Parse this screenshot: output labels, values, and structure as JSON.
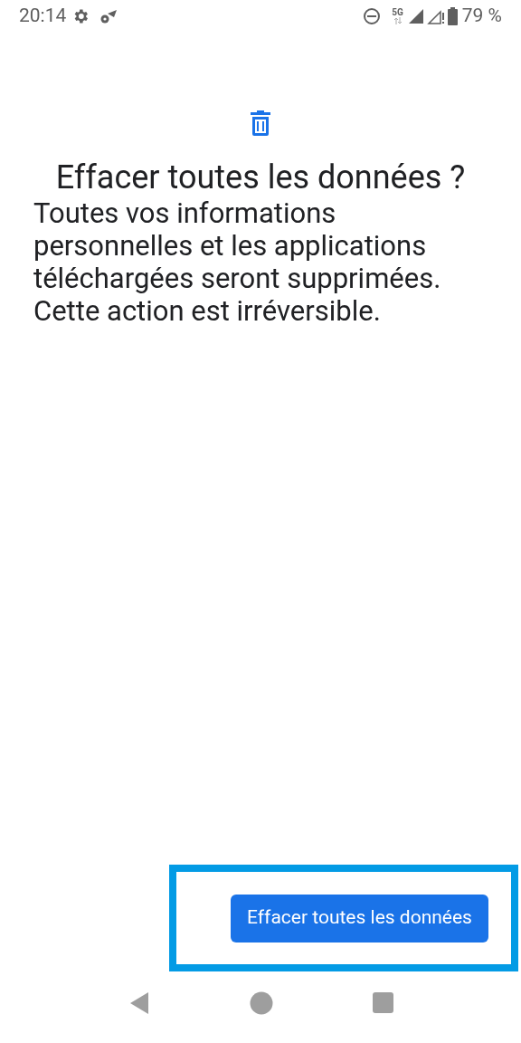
{
  "status_bar": {
    "time": "20:14",
    "network": "5G",
    "battery": "79 %"
  },
  "dialog": {
    "title": "Effacer toutes les données ?",
    "message": "Toutes vos informations personnelles et les applications téléchargées seront supprimées. Cette action est irréversible."
  },
  "action_button": {
    "label": "Effacer toutes les données",
    "highlighted": true
  }
}
